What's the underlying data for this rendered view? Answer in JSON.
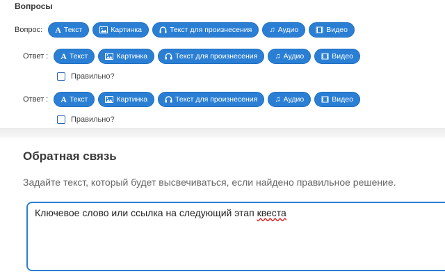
{
  "questions": {
    "title": "Вопросы",
    "question_row": {
      "label": "Вопрос:",
      "buttons": [
        "Текст",
        "Картинка",
        "Текст для произнесения",
        "Аудио",
        "Видео"
      ]
    },
    "answers": [
      {
        "label": "Ответ :",
        "buttons": [
          "Текст",
          "Картинка",
          "Текст для произнесения",
          "Аудио",
          "Видео"
        ],
        "correct_label": "Правильно?"
      },
      {
        "label": "Ответ :",
        "buttons": [
          "Текст",
          "Картинка",
          "Текст для произнесения",
          "Аудио",
          "Видео"
        ],
        "correct_label": "Правильно?"
      }
    ]
  },
  "feedback": {
    "title": "Обратная связь",
    "description": "Задайте текст, который будет высвечиваться, если найдено правильное решение.",
    "text_before": "Ключевое слово или ссылка на следующий этап ",
    "text_misspelled": "квеста"
  },
  "icons": [
    "text-icon",
    "picture-icon",
    "headphones-icon",
    "music-icon",
    "film-icon"
  ],
  "colors": {
    "button": "#2a7fd4",
    "text": "#333333",
    "textarea_border": "#2a7fd4"
  }
}
